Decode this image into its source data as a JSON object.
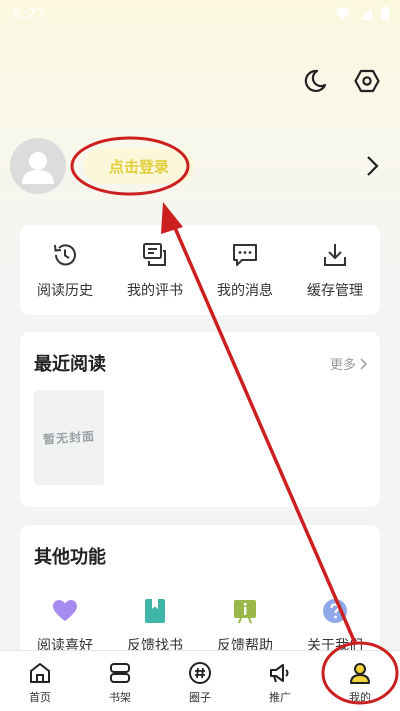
{
  "status": {
    "time": "6:27"
  },
  "profile": {
    "login_label": "点击登录"
  },
  "quick_actions": [
    {
      "label": "阅读历史",
      "icon": "history-icon"
    },
    {
      "label": "我的评书",
      "icon": "review-icon"
    },
    {
      "label": "我的消息",
      "icon": "message-icon"
    },
    {
      "label": "缓存管理",
      "icon": "download-icon"
    }
  ],
  "recent": {
    "title": "最近阅读",
    "more_label": "更多",
    "cover_placeholder": "暂无封面"
  },
  "other": {
    "title": "其他功能",
    "items": [
      {
        "label": "阅读喜好",
        "icon": "heart-icon",
        "color": "#a78bf0"
      },
      {
        "label": "反馈找书",
        "icon": "bookmark-book-icon",
        "color": "#3fb6a8"
      },
      {
        "label": "反馈帮助",
        "icon": "info-board-icon",
        "color": "#9ab84a"
      },
      {
        "label": "关于我们",
        "icon": "question-circle-icon",
        "color": "#8fa8e8"
      }
    ]
  },
  "nav": [
    {
      "label": "首页",
      "icon": "home-icon"
    },
    {
      "label": "书架",
      "icon": "bookshelf-icon"
    },
    {
      "label": "圈子",
      "icon": "hashtag-icon"
    },
    {
      "label": "推广",
      "icon": "megaphone-icon"
    },
    {
      "label": "我的",
      "icon": "person-icon"
    }
  ],
  "colors": {
    "accent_yellow": "#f2d33a",
    "login_text": "#e2cf3c",
    "annotation_red": "#cc1f1f"
  }
}
